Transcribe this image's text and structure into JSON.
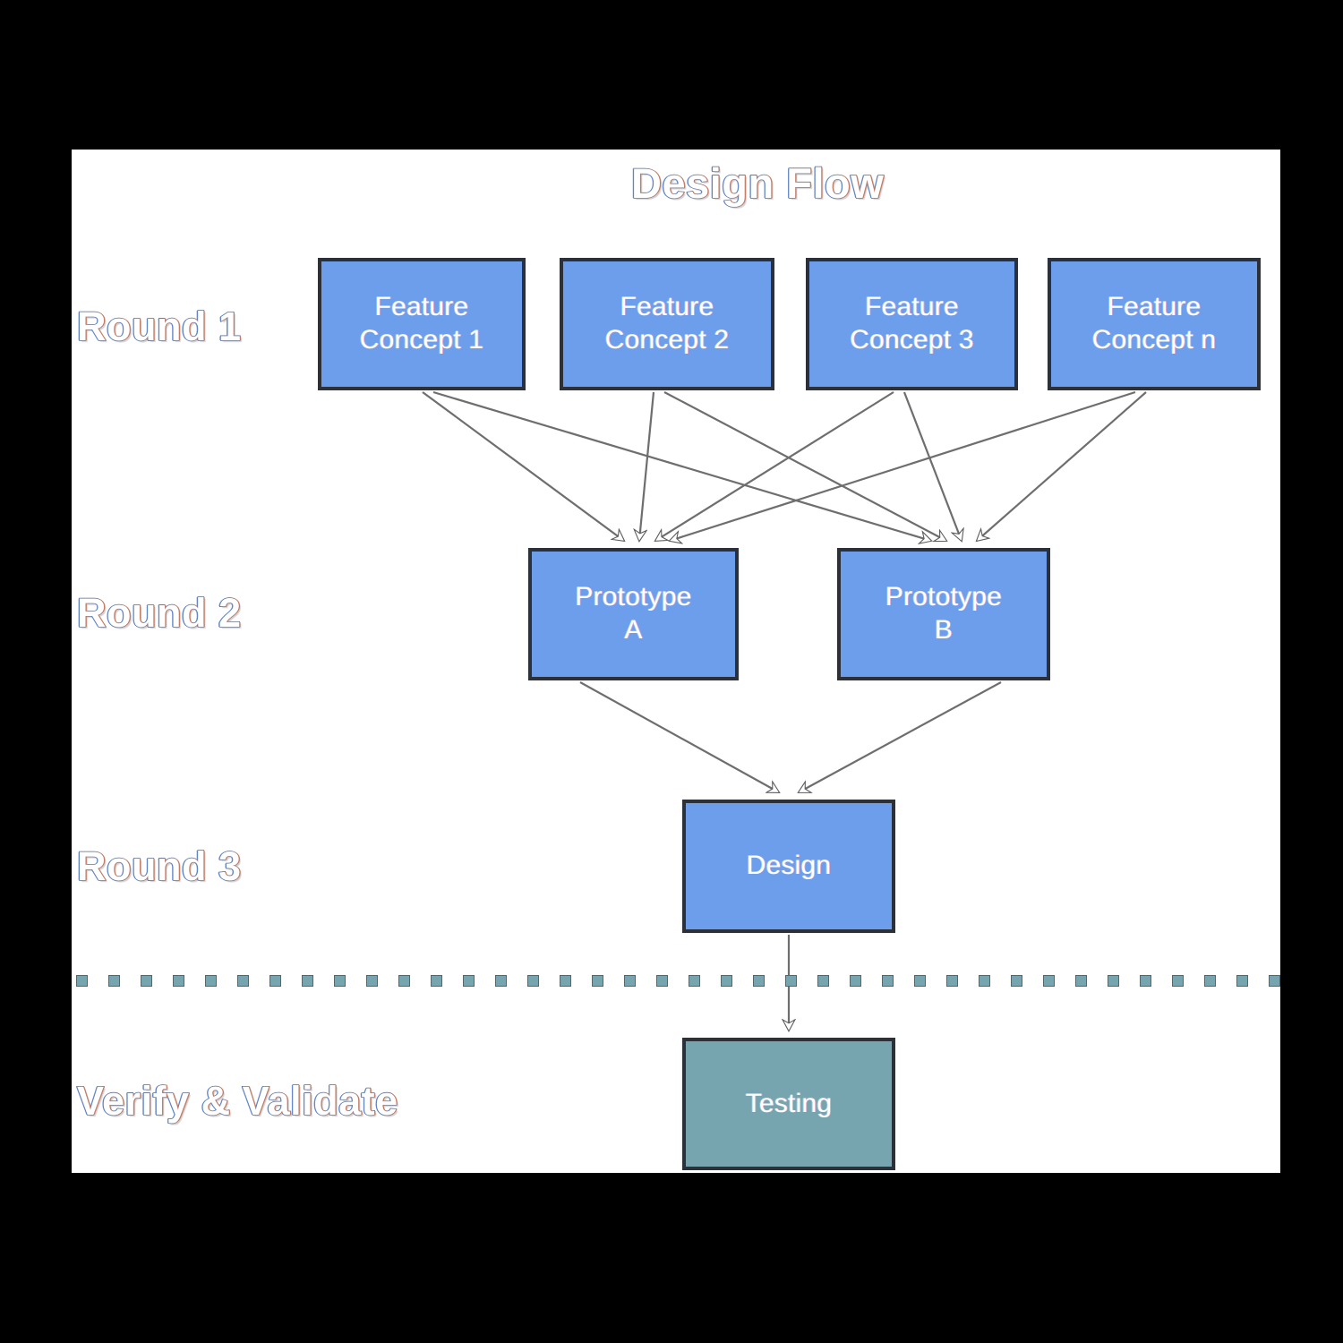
{
  "diagram": {
    "title": "Design Flow",
    "background_color": "#ffffff",
    "surround_color": "#000000",
    "node_fill_blue": "#6d9eeb",
    "node_fill_teal": "#76a5af",
    "node_border_color": "#2c3139",
    "node_text_color": "#ffffff",
    "divider_dot_color": "#76a5af",
    "connector_style": "open-white-arrowhead"
  },
  "row_labels": [
    {
      "id": "round-1",
      "text": "Round 1"
    },
    {
      "id": "round-2",
      "text": "Round 2"
    },
    {
      "id": "round-3",
      "text": "Round 3"
    },
    {
      "id": "verify-validate",
      "text": "Verify & Validate"
    }
  ],
  "nodes": {
    "round1": [
      {
        "id": "feature-concept-1",
        "line1": "Feature",
        "line2": "Concept 1",
        "fill": "blue"
      },
      {
        "id": "feature-concept-2",
        "line1": "Feature",
        "line2": "Concept 2",
        "fill": "blue"
      },
      {
        "id": "feature-concept-3",
        "line1": "Feature",
        "line2": "Concept 3",
        "fill": "blue"
      },
      {
        "id": "feature-concept-n",
        "line1": "Feature",
        "line2": "Concept n",
        "fill": "blue"
      }
    ],
    "round2": [
      {
        "id": "prototype-a",
        "line1": "Prototype",
        "line2": "A",
        "fill": "blue"
      },
      {
        "id": "prototype-b",
        "line1": "Prototype",
        "line2": "B",
        "fill": "blue"
      }
    ],
    "round3": [
      {
        "id": "design",
        "line1": "Design",
        "line2": "",
        "fill": "blue"
      }
    ],
    "verify_validate": [
      {
        "id": "testing",
        "line1": "Testing",
        "line2": "",
        "fill": "teal"
      }
    ]
  },
  "edges": [
    {
      "from": "feature-concept-1",
      "to": "prototype-a"
    },
    {
      "from": "feature-concept-1",
      "to": "prototype-b"
    },
    {
      "from": "feature-concept-2",
      "to": "prototype-a"
    },
    {
      "from": "feature-concept-2",
      "to": "prototype-b"
    },
    {
      "from": "feature-concept-3",
      "to": "prototype-a"
    },
    {
      "from": "feature-concept-3",
      "to": "prototype-b"
    },
    {
      "from": "feature-concept-n",
      "to": "prototype-a"
    },
    {
      "from": "feature-concept-n",
      "to": "prototype-b"
    },
    {
      "from": "prototype-a",
      "to": "design"
    },
    {
      "from": "prototype-b",
      "to": "design"
    },
    {
      "from": "design",
      "to": "testing"
    }
  ]
}
